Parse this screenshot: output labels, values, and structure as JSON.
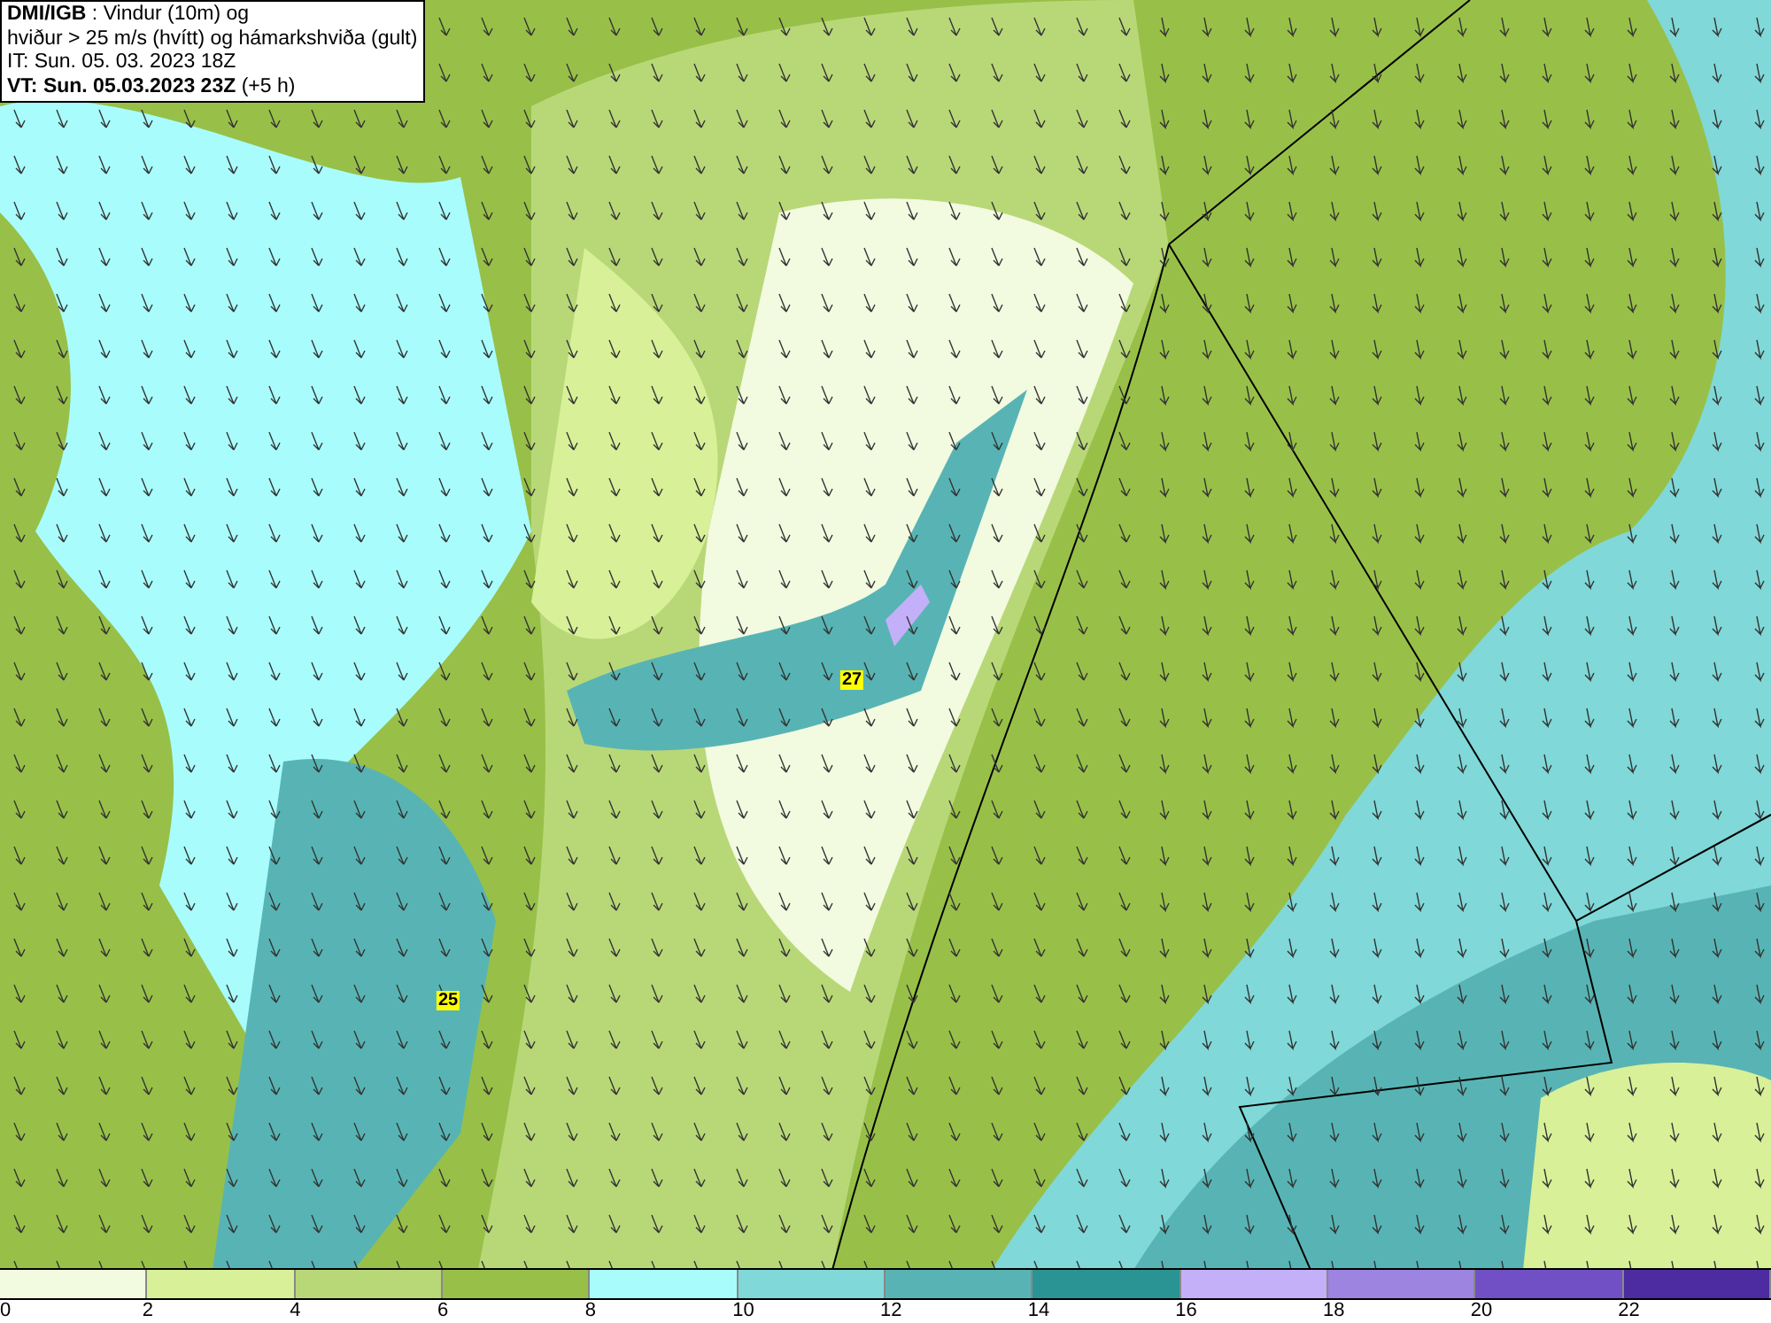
{
  "header": {
    "lines": [
      "**DMI/IGB** : Vindur (10m) og",
      "hviður > 25 m/s (hvítt) og hámarkshviða (gult)",
      "IT: Sun. 05. 03. 2023 18Z",
      "**VT: Sun. 05.03.2023 23Z** (+5 h)"
    ]
  },
  "map": {
    "gust_labels": [
      {
        "text": "27"
      },
      {
        "text": "25"
      }
    ]
  },
  "legend": {
    "bins": [
      {
        "color": "#f2fae0",
        "tick": "0"
      },
      {
        "color": "#d8f098",
        "tick": "2"
      },
      {
        "color": "#b8d878",
        "tick": "4"
      },
      {
        "color": "#98c048",
        "tick": "6"
      },
      {
        "color": "#a8fcfc",
        "tick": "8"
      },
      {
        "color": "#80d8d8",
        "tick": "10"
      },
      {
        "color": "#58b4b4",
        "tick": "12"
      },
      {
        "color": "#2a9494",
        "tick": "14"
      },
      {
        "color": "#c4b0f8",
        "tick": "16"
      },
      {
        "color": "#9c84e0",
        "tick": "18"
      },
      {
        "color": "#7050c4",
        "tick": "20"
      },
      {
        "color": "#4c2ca0",
        "tick": "22"
      }
    ]
  }
}
